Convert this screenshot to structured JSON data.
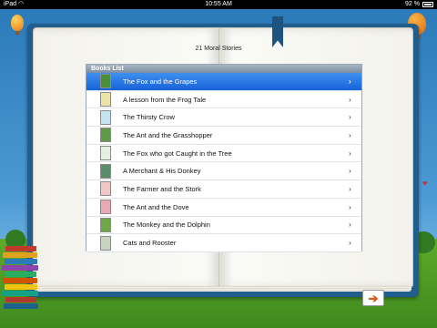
{
  "status_bar": {
    "carrier": "iPad",
    "time": "10:55 AM",
    "battery": "92 %"
  },
  "page_title": "21 Moral Stories",
  "books_list": {
    "header": "Books List",
    "selected_index": 0,
    "items": [
      {
        "title": "The Fox and the Grapes",
        "thumb_color": "#4a8f3a"
      },
      {
        "title": "A lesson from the Frog Tale",
        "thumb_color": "#ece4a6"
      },
      {
        "title": "The Thirsty Crow",
        "thumb_color": "#c4e2f0"
      },
      {
        "title": "The Ant and the Grasshopper",
        "thumb_color": "#5f9a48"
      },
      {
        "title": "The Fox who got Caught in the Tree",
        "thumb_color": "#e6efe0"
      },
      {
        "title": "A Merchant & His Donkey",
        "thumb_color": "#5a8e6a"
      },
      {
        "title": "The Farmer and the Stork",
        "thumb_color": "#f0c6c6"
      },
      {
        "title": "The Ant and the Dove",
        "thumb_color": "#e8a8b4"
      },
      {
        "title": "The Monkey and the Dolphin",
        "thumb_color": "#6ea84a"
      },
      {
        "title": "Cats and Rooster",
        "thumb_color": "#c8d4c0"
      }
    ]
  },
  "icons": {
    "chevron": "chevron-right-icon",
    "next": "next-page-arrow-icon"
  },
  "chevron_glyph": "›",
  "next_glyph": "➔",
  "colors": {
    "selected_row": "#2a77e6",
    "book_cover": "#1f5e8d",
    "next_arrow": "#e05a12"
  }
}
